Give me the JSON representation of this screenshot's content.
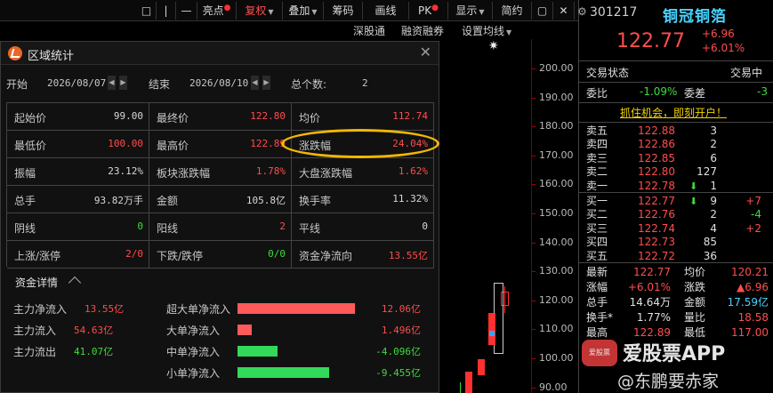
{
  "toolbar": {
    "items": [
      "亮点",
      "复权",
      "叠加",
      "筹码",
      "画线",
      "PK",
      "显示",
      "简约"
    ],
    "sub_items": [
      "深股通",
      "融资融券",
      "设置均线"
    ]
  },
  "dialog": {
    "title": "区域统计",
    "start_label": "开始",
    "start_date": "2026/08/07",
    "end_label": "结束",
    "end_date": "2026/08/10",
    "count_label": "总个数:",
    "count_value": "2",
    "stats": [
      {
        "label": "起始价",
        "value": "99.00",
        "tone": "white"
      },
      {
        "label": "最终价",
        "value": "122.80",
        "tone": "red"
      },
      {
        "label": "均价",
        "value": "112.74",
        "tone": "red"
      },
      {
        "label": "最低价",
        "value": "100.00",
        "tone": "red"
      },
      {
        "label": "最高价",
        "value": "122.89",
        "tone": "red"
      },
      {
        "label": "涨跌幅",
        "value": "24.04%",
        "tone": "red"
      },
      {
        "label": "振幅",
        "value": "23.12%",
        "tone": "white"
      },
      {
        "label": "板块涨跌幅",
        "value": "1.78%",
        "tone": "red"
      },
      {
        "label": "大盘涨跌幅",
        "value": "1.62%",
        "tone": "red"
      },
      {
        "label": "总手",
        "value": "93.82万手",
        "tone": "white"
      },
      {
        "label": "金额",
        "value": "105.8亿",
        "tone": "white"
      },
      {
        "label": "换手率",
        "value": "11.32%",
        "tone": "white"
      },
      {
        "label": "阴线",
        "value": "0",
        "tone": "green"
      },
      {
        "label": "阳线",
        "value": "2",
        "tone": "red"
      },
      {
        "label": "平线",
        "value": "0",
        "tone": "white"
      },
      {
        "label": "上涨/涨停",
        "value": "2/0",
        "tone": "red"
      },
      {
        "label": "下跌/跌停",
        "value": "0/0",
        "tone": "green"
      },
      {
        "label": "资金净流向",
        "value": "13.55亿",
        "tone": "red"
      }
    ],
    "fund_title": "资金详情",
    "left_flows": [
      {
        "label": "主力净流入",
        "value": "13.55亿",
        "tone": "red"
      },
      {
        "label": "主力流入",
        "value": "54.63亿",
        "tone": "red"
      },
      {
        "label": "主力流出",
        "value": "41.07亿",
        "tone": "green"
      }
    ],
    "right_flows": [
      {
        "label": "超大单净流入",
        "value": "12.06亿",
        "amount": 12.06,
        "tone": "red"
      },
      {
        "label": "大单净流入",
        "value": "1.496亿",
        "amount": 1.496,
        "tone": "red"
      },
      {
        "label": "中单净流入",
        "value": "-4.096亿",
        "amount": -4.096,
        "tone": "green"
      },
      {
        "label": "小单净流入",
        "value": "-9.455亿",
        "amount": -9.455,
        "tone": "green"
      }
    ]
  },
  "chart": {
    "y_ticks": [
      "200.00",
      "190.00",
      "180.00",
      "170.00",
      "160.00",
      "150.00",
      "140.00",
      "130.00",
      "120.00",
      "110.00",
      "100.00",
      "90.00"
    ]
  },
  "quote": {
    "code": "301217",
    "name": "铜冠铜箔",
    "price": "122.77",
    "change": "+6.96",
    "change_pct": "+6.01%",
    "status_label": "交易状态",
    "status_value": "交易中",
    "weibi_label": "委比",
    "weibi_value": "-1.09%",
    "weicha_label": "委差",
    "weicha_value": "-3",
    "promo": "抓住机会，即刻开户！",
    "asks": [
      {
        "label": "卖五",
        "price": "122.88",
        "vol": "3",
        "chg": ""
      },
      {
        "label": "卖四",
        "price": "122.86",
        "vol": "2",
        "chg": ""
      },
      {
        "label": "卖三",
        "price": "122.85",
        "vol": "6",
        "chg": ""
      },
      {
        "label": "卖二",
        "price": "122.80",
        "vol": "127",
        "chg": ""
      },
      {
        "label": "卖一",
        "price": "122.78",
        "vol": "1",
        "chg": ""
      }
    ],
    "bids": [
      {
        "label": "买一",
        "price": "122.77",
        "vol": "9",
        "chg": "+7"
      },
      {
        "label": "买二",
        "price": "122.76",
        "vol": "2",
        "chg": "-4"
      },
      {
        "label": "买三",
        "price": "122.74",
        "vol": "4",
        "chg": "+2"
      },
      {
        "label": "买四",
        "price": "122.73",
        "vol": "85",
        "chg": ""
      },
      {
        "label": "买五",
        "price": "122.72",
        "vol": "36",
        "chg": ""
      }
    ],
    "details": [
      {
        "l1": "最新",
        "v1": "122.77",
        "l2": "均价",
        "v2": "120.21"
      },
      {
        "l1": "涨幅",
        "v1": "+6.01%",
        "l2": "涨跌",
        "v2": "▲6.96"
      },
      {
        "l1": "总手",
        "v1": "14.64万",
        "l2": "金额",
        "v2": "17.59亿"
      },
      {
        "l1": "换手*",
        "v1": "1.77%",
        "l2": "量比",
        "v2": "18.58"
      },
      {
        "l1": "最高",
        "v1": "122.89",
        "l2": "最低",
        "v2": "117.00"
      }
    ]
  },
  "watermark": {
    "app": "爱股票APP",
    "signature": "@东鹏要赤家"
  }
}
